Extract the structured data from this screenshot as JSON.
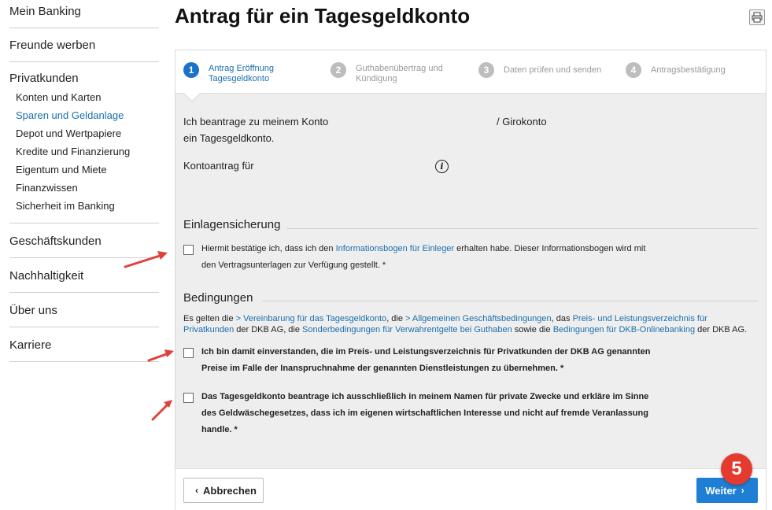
{
  "sidebar": {
    "mein_banking": "Mein Banking",
    "freunde_werben": "Freunde werben",
    "privatkunden": {
      "title": "Privatkunden",
      "items": [
        "Konten und Karten",
        "Sparen und Geldanlage",
        "Depot und Wertpapiere",
        "Kredite und Finanzierung",
        "Eigentum und Miete",
        "Finanzwissen",
        "Sicherheit im Banking"
      ]
    },
    "geschaeftskunden": "Geschäftskunden",
    "nachhaltigkeit": "Nachhaltigkeit",
    "ueber_uns": "Über uns",
    "karriere": "Karriere"
  },
  "page_title": "Antrag für ein Tagesgeldkonto",
  "steps": [
    {
      "num": "1",
      "line1": "Antrag Eröffnung",
      "line2": "Tagesgeldkonto"
    },
    {
      "num": "2",
      "line1": "Guthabenübertrag und",
      "line2": "Kündigung"
    },
    {
      "num": "3",
      "line1": "Daten prüfen und senden",
      "line2": ""
    },
    {
      "num": "4",
      "line1": "Antragsbestätigung",
      "line2": ""
    }
  ],
  "form": {
    "intro_line1": "Ich beantrage zu meinem Konto",
    "intro_girokonto": "/ Girokonto",
    "intro_line2": "ein Tagesgeldkonto.",
    "kontoantrag_label": "Kontoantrag für",
    "info_glyph": "i"
  },
  "einlagensicherung": {
    "heading": "Einlagensicherung",
    "text_before": "Hiermit bestätige ich, dass ich den ",
    "link": "Informationsbogen für Einleger",
    "text_after": " erhalten habe. Dieser Informationsbogen wird mit",
    "line2": "den Vertragsunterlagen zur Verfügung gestellt. *"
  },
  "bedingungen": {
    "heading": "Bedingungen",
    "p_es_gelten": "Es gelten die ",
    "link1": "> Vereinbarung für das Tagesgeldkonto",
    "p_die": ", die ",
    "link2": "> Allgemeinen Geschäftsbedingungen",
    "p_das": ", das ",
    "link3a": "Preis- und Leistungsverzeichnis für",
    "link3b": "Privatkunden",
    "p_dkb": " der DKB AG, die ",
    "link4": "Sonderbedingungen für Verwahrentgelte bei Guthaben",
    "p_sowie": " sowie die ",
    "link5": "Bedingungen für DKB-Onlinebanking",
    "p_end": " der DKB AG.",
    "cb2_line1": "Ich bin damit einverstanden, die im Preis- und Leistungsverzeichnis für Privatkunden der DKB AG genannten",
    "cb2_line2": "Preise im Falle der Inanspruchnahme der genannten Dienstleistungen zu übernehmen. *",
    "cb3_line1": "Das Tagesgeldkonto beantrage ich ausschließlich in meinem Namen für private Zwecke und erkläre im Sinne",
    "cb3_line2": "des Geldwäschegesetzes, dass ich im eigenen wirtschaftlichen Interesse und nicht auf fremde Veranlassung",
    "cb3_line3": "handle. *"
  },
  "buttons": {
    "cancel": "Abbrechen",
    "next": "Weiter"
  },
  "badge": "5",
  "colors": {
    "accent": "#1a73c8",
    "link": "#1a6fae",
    "badge": "#e53a2f",
    "arrow": "#e0413a"
  }
}
